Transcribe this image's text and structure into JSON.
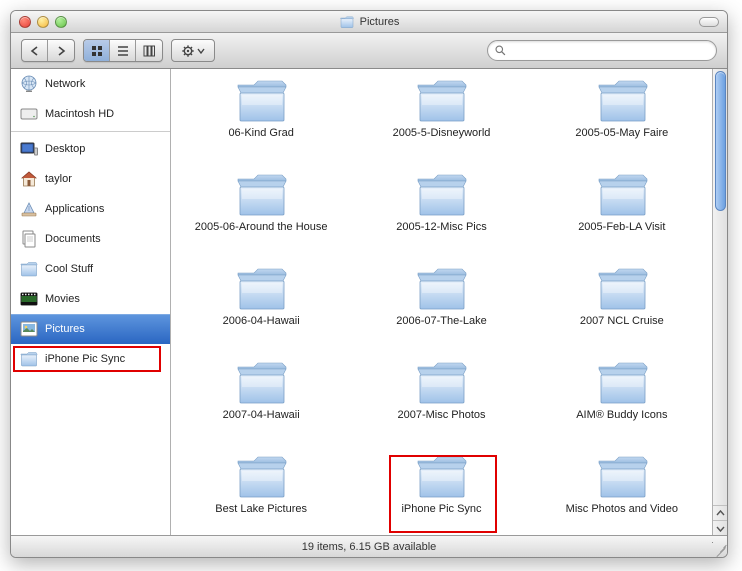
{
  "window": {
    "title": "Pictures"
  },
  "toolbar": {
    "search_placeholder": ""
  },
  "sidebar": {
    "items": [
      {
        "label": "Network",
        "icon": "globe"
      },
      {
        "label": "Macintosh HD",
        "icon": "hd"
      },
      {
        "label": "Desktop",
        "icon": "desktop"
      },
      {
        "label": "taylor",
        "icon": "home"
      },
      {
        "label": "Applications",
        "icon": "apps"
      },
      {
        "label": "Documents",
        "icon": "docs"
      },
      {
        "label": "Cool Stuff",
        "icon": "folder"
      },
      {
        "label": "Movies",
        "icon": "movies"
      },
      {
        "label": "Pictures",
        "icon": "pictures",
        "selected": true
      },
      {
        "label": "iPhone Pic Sync",
        "icon": "folder",
        "highlighted": true
      }
    ]
  },
  "folders": [
    {
      "name": "06-Kind Grad"
    },
    {
      "name": "2005-5-Disneyworld"
    },
    {
      "name": "2005-05-May Faire"
    },
    {
      "name": "2005-06-Around the House"
    },
    {
      "name": "2005-12-Misc Pics"
    },
    {
      "name": "2005-Feb-LA Visit"
    },
    {
      "name": "2006-04-Hawaii"
    },
    {
      "name": "2006-07-The-Lake"
    },
    {
      "name": "2007 NCL Cruise"
    },
    {
      "name": "2007-04-Hawaii"
    },
    {
      "name": "2007-Misc Photos"
    },
    {
      "name": "AIM® Buddy Icons"
    },
    {
      "name": "Best Lake Pictures"
    },
    {
      "name": "iPhone Pic Sync",
      "highlighted": true
    },
    {
      "name": "Misc Photos and Video"
    }
  ],
  "status": {
    "text": "19 items, 6.15 GB available"
  },
  "colors": {
    "selection_blue_top": "#5f96de",
    "selection_blue_bottom": "#2a66c2",
    "highlight_red": "#e00000",
    "folder_blue_light": "#cfe4f9",
    "folder_blue_dark": "#8fb9e6"
  }
}
